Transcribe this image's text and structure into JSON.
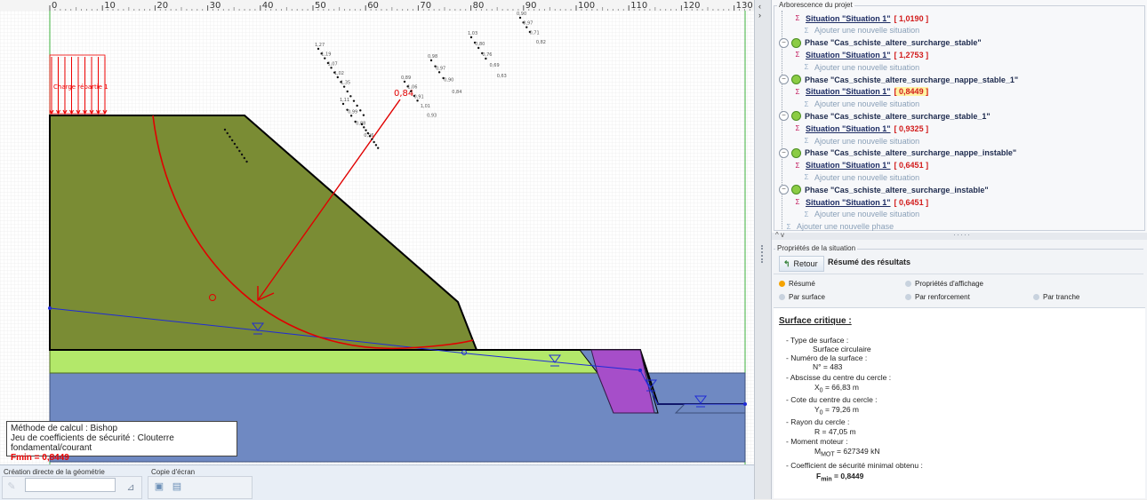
{
  "canvas": {
    "ruler_ticks": [
      "0",
      "10",
      "20",
      "30",
      "40",
      "50",
      "60",
      "70",
      "80",
      "90",
      "100",
      "110",
      "120",
      "130"
    ],
    "load_label": "Charge répartie 1",
    "critical_fs_label": "0,84",
    "fs_labels": [
      "1,27",
      "1,19",
      "1,07",
      "1,02",
      "1,35",
      "1,11",
      "0,99",
      "0,88",
      "0,96",
      "0,89",
      "1,06",
      "0,91",
      "1,01",
      "0,93",
      "0,98",
      "0,97",
      "0,90",
      "0,84",
      "1,03",
      "0,80",
      "0,76",
      "0,69",
      "0,63",
      "0,90",
      "0,97",
      "0,71",
      "0,82",
      "0,71"
    ],
    "colors": {
      "upper_layer": "#7a8c34",
      "middle_layer": "#b3e86a",
      "lower_layer": "#6f89c2",
      "reinforcement": "#a64ec9",
      "slip_circle": "#e00000",
      "water_line": "#1f2bd6"
    }
  },
  "method_box": {
    "line1": "Méthode de calcul : Bishop",
    "line2": "Jeu de coefficients de sécurité : Clouterre fondamental/courant",
    "fmin": "Fmin = 0,8449"
  },
  "bottom_bar": {
    "geometry_group": "Création directe de la géométrie",
    "screenshot_group": "Copie d'écran",
    "geometry_value": ""
  },
  "tree": {
    "title": "Arborescence du projet",
    "rows": [
      {
        "kind": "situation",
        "label": "Situation \"Situation 1\"",
        "value": "[ 1,0190 ]"
      },
      {
        "kind": "add",
        "label": "Ajouter une nouvelle situation"
      },
      {
        "kind": "phase",
        "label": "Phase \"Cas_schiste_altere_surcharge_stable\""
      },
      {
        "kind": "situation",
        "label": "Situation \"Situation 1\"",
        "value": "[ 1,2753 ]"
      },
      {
        "kind": "add",
        "label": "Ajouter une nouvelle situation"
      },
      {
        "kind": "phase",
        "label": "Phase \"Cas_schiste_altere_surcharge_nappe_stable_1\""
      },
      {
        "kind": "situation",
        "label": "Situation \"Situation 1\"",
        "value": "[ 0,8449 ]",
        "highlight": true
      },
      {
        "kind": "add",
        "label": "Ajouter une nouvelle situation"
      },
      {
        "kind": "phase",
        "label": "Phase \"Cas_schiste_altere_surcharge_stable_1\""
      },
      {
        "kind": "situation",
        "label": "Situation \"Situation 1\"",
        "value": "[ 0,9325 ]"
      },
      {
        "kind": "add",
        "label": "Ajouter une nouvelle situation"
      },
      {
        "kind": "phase",
        "label": "Phase \"Cas_schiste_altere_surcharge_nappe_instable\""
      },
      {
        "kind": "situation",
        "label": "Situation \"Situation 1\"",
        "value": "[ 0,6451 ]"
      },
      {
        "kind": "add",
        "label": "Ajouter une nouvelle situation"
      },
      {
        "kind": "phase",
        "label": "Phase \"Cas_schiste_altere_surcharge_instable\""
      },
      {
        "kind": "situation",
        "label": "Situation \"Situation 1\"",
        "value": "[ 0,6451 ]"
      },
      {
        "kind": "add",
        "label": "Ajouter une nouvelle situation"
      },
      {
        "kind": "add-phase",
        "label": "Ajouter une nouvelle phase"
      }
    ]
  },
  "props": {
    "title": "Propriétés de la situation",
    "retour": "Retour",
    "resume_title": "Résumé des résultats",
    "options": [
      "Résumé",
      "Propriétés d'affichage",
      "Par surface",
      "Par renforcement",
      "Par tranche"
    ],
    "selected_option": "Résumé",
    "summary": {
      "heading": "Surface critique :",
      "lines": [
        "- Type de surface :",
        "Surface circulaire",
        "- Numéro de la surface :",
        "N° = 483",
        "- Abscisse du centre du cercle :",
        "X",
        "0",
        "= 66,83 m",
        "- Cote du centre du cercle :",
        "Y",
        "0",
        "= 79,26 m",
        "- Rayon du cercle :",
        "R = 47,05 m",
        "- Moment moteur :",
        "M",
        "MOT",
        "= 627349 kN",
        "- Coefficient de sécurité minimal obtenu :",
        "F",
        "min",
        "= 0,8449"
      ]
    }
  }
}
